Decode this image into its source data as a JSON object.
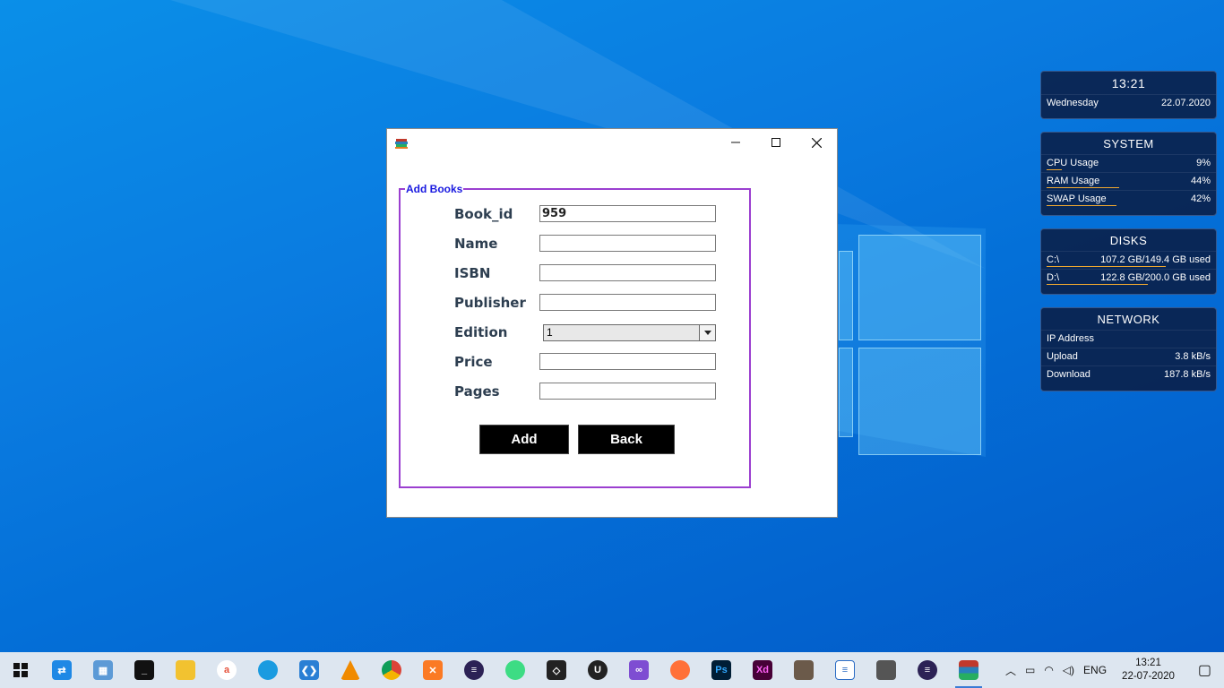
{
  "window": {
    "group_title": "Add Books",
    "fields": [
      {
        "label": "Book_id",
        "value": "959"
      },
      {
        "label": "Name",
        "value": ""
      },
      {
        "label": "ISBN",
        "value": ""
      },
      {
        "label": "Publisher",
        "value": ""
      },
      {
        "label": "Edition",
        "value": "1"
      },
      {
        "label": "Price",
        "value": ""
      },
      {
        "label": "Pages",
        "value": ""
      }
    ],
    "add_label": "Add",
    "back_label": "Back"
  },
  "widgets": {
    "clock": {
      "time": "13:21",
      "day": "Wednesday",
      "date": "22.07.2020"
    },
    "system": {
      "title": "SYSTEM",
      "rows": [
        {
          "label": "CPU Usage",
          "value": "9%",
          "level": 0.09
        },
        {
          "label": "RAM Usage",
          "value": "44%",
          "level": 0.44
        },
        {
          "label": "SWAP Usage",
          "value": "42%",
          "level": 0.42
        }
      ]
    },
    "disks": {
      "title": "DISKS",
      "rows": [
        {
          "label": "C:\\",
          "value": "107.2 GB/149.4 GB used",
          "level": 0.72
        },
        {
          "label": "D:\\",
          "value": "122.8 GB/200.0 GB used",
          "level": 0.61
        }
      ]
    },
    "network": {
      "title": "NETWORK",
      "rows": [
        {
          "label": "IP Address",
          "value": ""
        },
        {
          "label": "Upload",
          "value": "3.8 kB/s"
        },
        {
          "label": "Download",
          "value": "187.8 kB/s"
        }
      ]
    }
  },
  "taskbar": {
    "tray_lang": "ENG",
    "clock_time": "13:21",
    "clock_date": "22-07-2020"
  }
}
